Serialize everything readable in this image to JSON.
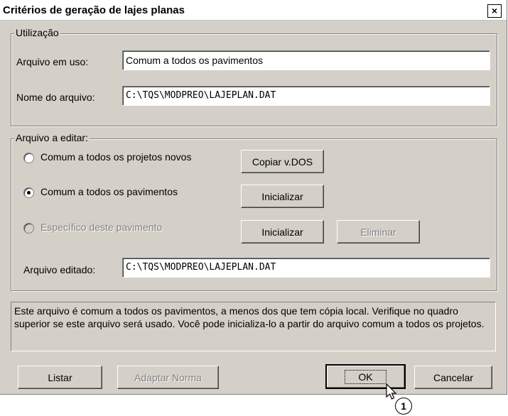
{
  "window": {
    "title": "Critérios de geração de lajes planas",
    "close_glyph": "×"
  },
  "usage_group": {
    "legend": "Utilização",
    "file_in_use_label": "Arquivo em uso:",
    "file_in_use_value": "Comum a todos os pavimentos",
    "file_name_label": "Nome do arquivo:",
    "file_name_value": "C:\\TQS\\MODPREO\\LAJEPLAN.DAT"
  },
  "edit_group": {
    "legend": "Arquivo a editar:",
    "options": [
      {
        "label": "Comum a todos os projetos novos",
        "selected": false,
        "enabled": true
      },
      {
        "label": "Comum a todos os pavimentos",
        "selected": true,
        "enabled": true
      },
      {
        "label": "Específico deste pavimento",
        "selected": false,
        "enabled": false
      }
    ],
    "copy_dos_label": "Copiar v.DOS",
    "init_label_1": "Inicializar",
    "init_label_2": "Inicializar",
    "delete_label": "Eliminar",
    "edited_file_label": "Arquivo editado:",
    "edited_file_value": "C:\\TQS\\MODPREO\\LAJEPLAN.DAT"
  },
  "info_text": "Este arquivo é comum a todos os pavimentos, a menos dos que tem cópia local. Verifique no quadro superior se este arquivo será usado. Você pode inicializa-lo a partir do arquivo comum a todos os projetos.",
  "footer": {
    "list_label": "Listar",
    "adapt_label": "Adaptar Norma",
    "ok_label": "OK",
    "cancel_label": "Cancelar"
  },
  "annotation": {
    "callout_number": "1"
  }
}
